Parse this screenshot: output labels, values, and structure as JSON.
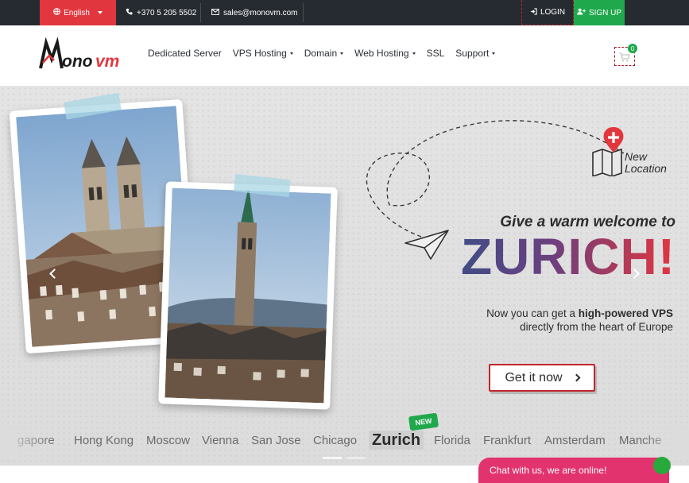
{
  "topbar": {
    "language": "English",
    "phone": "+370 5 205 5502",
    "email": "sales@monovm.com",
    "login": "LOGIN",
    "signup": "SIGN UP"
  },
  "brand": {
    "logo_text": "Monovm"
  },
  "nav": {
    "items": [
      {
        "label": "Dedicated Server"
      },
      {
        "label": "VPS Hosting"
      },
      {
        "label": "Domain"
      },
      {
        "label": "Web Hosting"
      },
      {
        "label": "SSL"
      },
      {
        "label": "Support"
      }
    ],
    "cart_count": "0"
  },
  "hero": {
    "new_location": [
      "New",
      "Location"
    ],
    "welcome": "Give a warm welcome to",
    "headline": "ZURICH!",
    "tagline_pre": "Now you can get a ",
    "tagline_bold": "high-powered VPS",
    "tagline_post": "directly from the heart of Europe",
    "cta": "Get it now"
  },
  "locations": {
    "cities": [
      "gapore",
      "Hong Kong",
      "Moscow",
      "Vienna",
      "San Jose",
      "Chicago",
      "Florida",
      "Frankfurt",
      "Amsterdam",
      "Manche"
    ],
    "featured": "Zurich",
    "badge": "NEW"
  },
  "chat": {
    "label": "Chat with us, we are online!"
  },
  "colors": {
    "accent_red": "#e2363e",
    "accent_green": "#20a84c",
    "dark_bar": "#262b31",
    "chat_pink": "#e2336e"
  }
}
